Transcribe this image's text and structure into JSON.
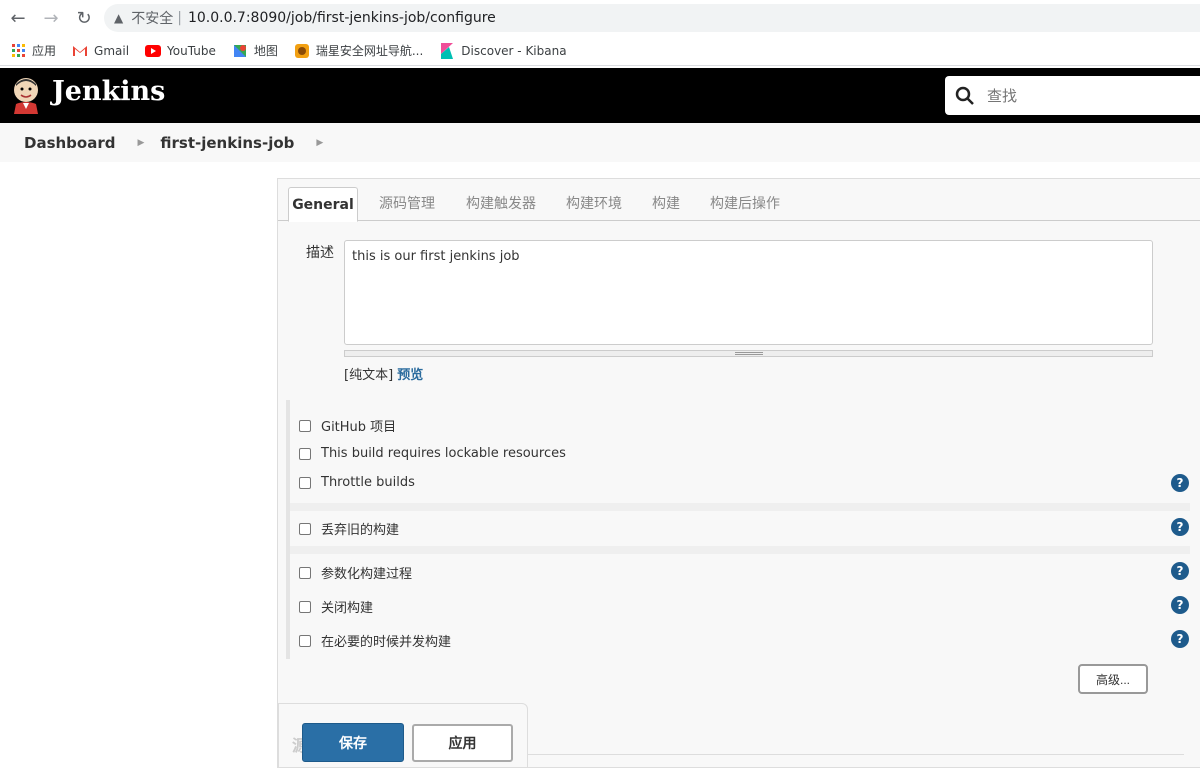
{
  "browser": {
    "insecure_label": "不安全",
    "url": "10.0.0.7:8090/job/first-jenkins-job/configure",
    "bookmarks": [
      {
        "label": "应用",
        "icon": "apps-grid-icon"
      },
      {
        "label": "Gmail",
        "icon": "gmail-icon"
      },
      {
        "label": "YouTube",
        "icon": "youtube-icon"
      },
      {
        "label": "地图",
        "icon": "maps-icon"
      },
      {
        "label": "瑞星安全网址导航...",
        "icon": "rising-lion-icon"
      },
      {
        "label": "Discover - Kibana",
        "icon": "kibana-icon"
      }
    ]
  },
  "header": {
    "title": "Jenkins",
    "search_placeholder": "查找"
  },
  "breadcrumb": [
    "Dashboard",
    "first-jenkins-job"
  ],
  "tabs": [
    "General",
    "源码管理",
    "构建触发器",
    "构建环境",
    "构建",
    "构建后操作"
  ],
  "general": {
    "description_label": "描述",
    "description_value": "this is our first jenkins job",
    "text_mode": "[纯文本]",
    "preview": "预览",
    "options": [
      "GitHub 项目",
      "This build requires lockable resources",
      "Throttle builds",
      "丢弃旧的构建",
      "参数化构建过程",
      "关闭构建",
      "在必要的时候并发构建"
    ],
    "advanced_button": "高级...",
    "help_glyph": "?"
  },
  "footer": {
    "save": "保存",
    "apply": "应用",
    "ghost_char": "源"
  },
  "colors": {
    "header_bg": "#000000",
    "primary_button": "#2a6fa6",
    "help_icon": "#1e5b8c",
    "link": "#2b6c9e"
  }
}
